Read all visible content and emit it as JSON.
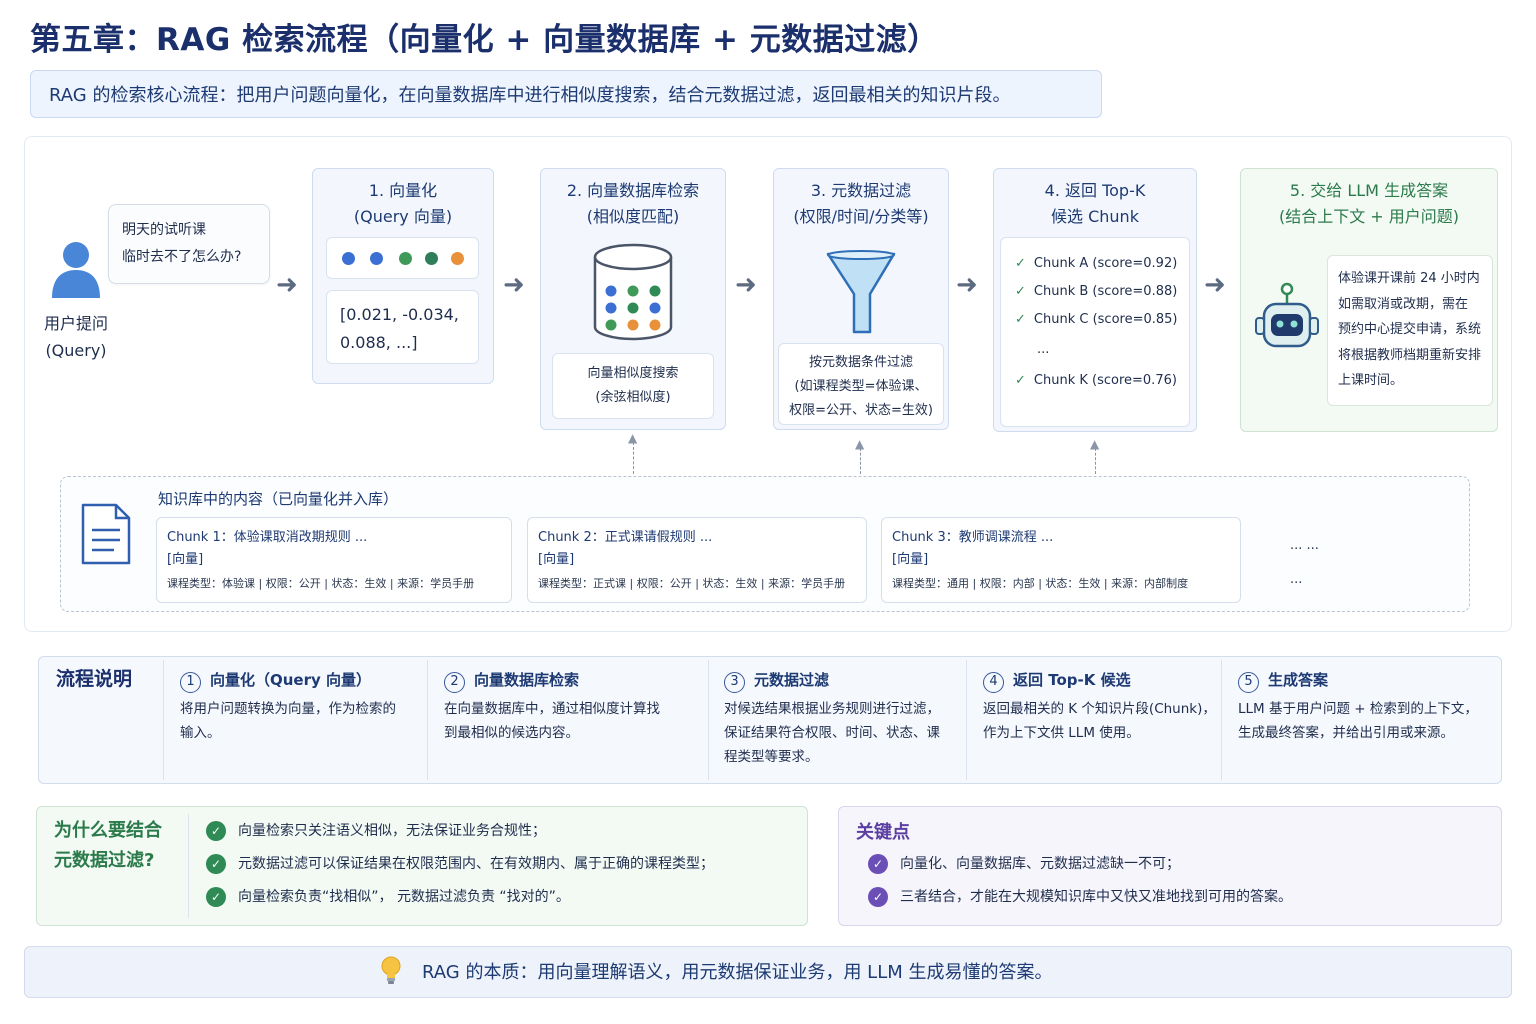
{
  "title": "第五章：RAG 检索流程（向量化 + 向量数据库 + 元数据过滤）",
  "intro": "RAG 的检索核心流程：把用户问题向量化，在向量数据库中进行相似度搜索，结合元数据过滤，返回最相关的知识片段。",
  "user": {
    "label_line1": "用户提问",
    "label_line2": "(Query)",
    "question_line1": "明天的试听课",
    "question_line2": "临时去不了怎么办?"
  },
  "stages": [
    {
      "line1": "1. 向量化",
      "line2": "(Query 向量)",
      "vector_line1": "[0.021, -0.034,",
      "vector_line2": "0.088, ...]"
    },
    {
      "line1": "2. 向量数据库检索",
      "line2": "(相似度匹配)",
      "caption_line1": "向量相似度搜索",
      "caption_line2": "(余弦相似度)"
    },
    {
      "line1": "3. 元数据过滤",
      "line2": "(权限/时间/分类等)",
      "caption_line1": "按元数据条件过滤",
      "caption_line2": "(如课程类型=体验课、",
      "caption_line3": "权限=公开、状态=生效)"
    },
    {
      "line1": "4. 返回 Top-K",
      "line2": "候选 Chunk",
      "chunks": [
        "Chunk A (score=0.92)",
        "Chunk B (score=0.88)",
        "Chunk C (score=0.85)",
        "...",
        "Chunk K (score=0.76)"
      ]
    },
    {
      "line1": "5. 交给 LLM 生成答案",
      "line2": "(结合上下文 + 用户问题)",
      "answer_lines": [
        "体验课开课前 24 小时内",
        "如需取消或改期，需在",
        "预约中心提交申请，系统",
        "将根据教师档期重新安排",
        "上课时间。"
      ]
    }
  ],
  "colors": {
    "vector_dots": [
      "#3b6fd4",
      "#3b6fd4",
      "#3f9a5a",
      "#2f7d5a",
      "#e8913a"
    ],
    "db_dots": [
      "#3b6fd4",
      "#3f9a5a",
      "#2f8a55",
      "#3b6fd4",
      "#2f8a55",
      "#3b6fd4",
      "#3f9a5a",
      "#e8913a",
      "#e8913a"
    ],
    "accent_blue": "#1a2f6b",
    "accent_green": "#2f8a55",
    "accent_purple": "#6b4fb6"
  },
  "knowledge_base": {
    "title": "知识库中的内容（已向量化并入库）",
    "chunks": [
      {
        "title": "Chunk 1：体验课取消改期规则 ...",
        "tag": "[向量]",
        "meta": "课程类型：体验课 | 权限：公开 | 状态：生效 | 来源：学员手册"
      },
      {
        "title": "Chunk 2：正式课请假规则 ...",
        "tag": "[向量]",
        "meta": "课程类型：正式课 | 权限：公开 | 状态：生效 | 来源：学员手册"
      },
      {
        "title": "Chunk 3：教师调课流程 ...",
        "tag": "[向量]",
        "meta": "课程类型：通用 | 权限：内部 | 状态：生效 | 来源：内部制度"
      }
    ],
    "more1": "... ...",
    "more2": "..."
  },
  "process": {
    "label": "流程说明",
    "steps": [
      {
        "num": "1",
        "title": "向量化（Query 向量）",
        "line1": "将用户问题转换为向量，作为检索的",
        "line2": "输入。"
      },
      {
        "num": "2",
        "title": "向量数据库检索",
        "line1": "在向量数据库中，通过相似度计算找",
        "line2": "到最相似的候选内容。"
      },
      {
        "num": "3",
        "title": "元数据过滤",
        "line1": "对候选结果根据业务规则进行过滤，",
        "line2": "保证结果符合权限、时间、状态、课",
        "line3": "程类型等要求。"
      },
      {
        "num": "4",
        "title": "返回 Top-K 候选",
        "line1": "返回最相关的 K 个知识片段(Chunk)，",
        "line2": "作为上下文供 LLM 使用。"
      },
      {
        "num": "5",
        "title": "生成答案",
        "line1": "LLM 基于用户问题 + 检索到的上下文，",
        "line2": "生成最终答案，并给出引用或来源。"
      }
    ]
  },
  "why": {
    "title_line1": "为什么要结合",
    "title_line2": "元数据过滤?",
    "items": [
      "向量检索只关注语义相似，无法保证业务合规性；",
      "元数据过滤可以保证结果在权限范围内、在有效期内、属于正确的课程类型；",
      "向量检索负责“找相似”， 元数据过滤负责 “找对的”。"
    ]
  },
  "key_points": {
    "title": "关键点",
    "items": [
      "向量化、向量数据库、元数据过滤缺一不可；",
      "三者结合，才能在大规模知识库中又快又准地找到可用的答案。"
    ]
  },
  "bottom": "RAG 的本质：用向量理解语义，用元数据保证业务，用 LLM 生成易懂的答案。"
}
